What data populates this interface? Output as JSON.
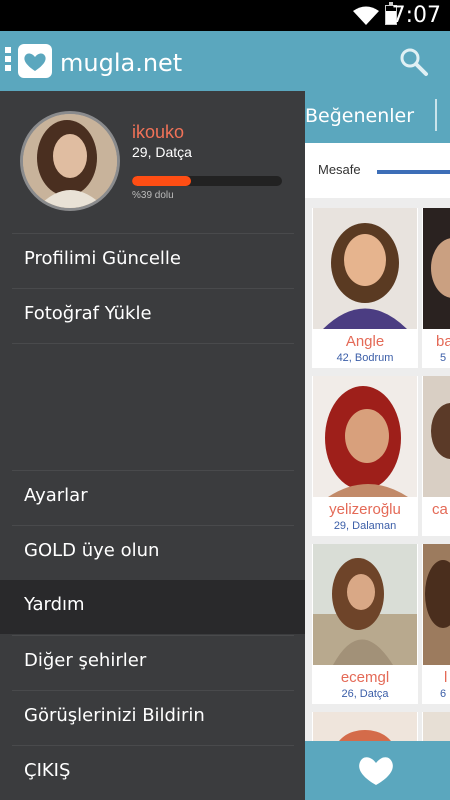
{
  "status": {
    "time": "7:07"
  },
  "app": {
    "title": "mugla.net"
  },
  "tabs": {
    "current": "Beğenenler"
  },
  "filter": {
    "label": "Mesafe"
  },
  "cards": [
    {
      "name": "Angle",
      "meta": "42, Bodrum"
    },
    {
      "name": "ba",
      "meta": "5"
    },
    {
      "name": "yelizeroğlu",
      "meta": "29, Dalaman"
    },
    {
      "name": "ca",
      "meta": ""
    },
    {
      "name": "ecemgl",
      "meta": "26, Datça"
    },
    {
      "name": "l",
      "meta": "6"
    }
  ],
  "profile": {
    "name": "ikouko",
    "location": "29, Datça",
    "completion_percent": 39,
    "completion_text": "%39 dolu"
  },
  "menu": {
    "update_profile": "Profilimi Güncelle",
    "upload_photo": "Fotoğraf Yükle",
    "settings": "Ayarlar",
    "gold": "GOLD üye olun",
    "help": "Yardım",
    "other_cities": "Diğer şehirler",
    "feedback": "Görüşlerinizi Bildirin",
    "logout": "ÇIKIŞ"
  },
  "colors": {
    "accent": "#5ba7be",
    "drawer": "#3b3c3e",
    "name": "#f17258",
    "progress": "#ff4e14"
  }
}
